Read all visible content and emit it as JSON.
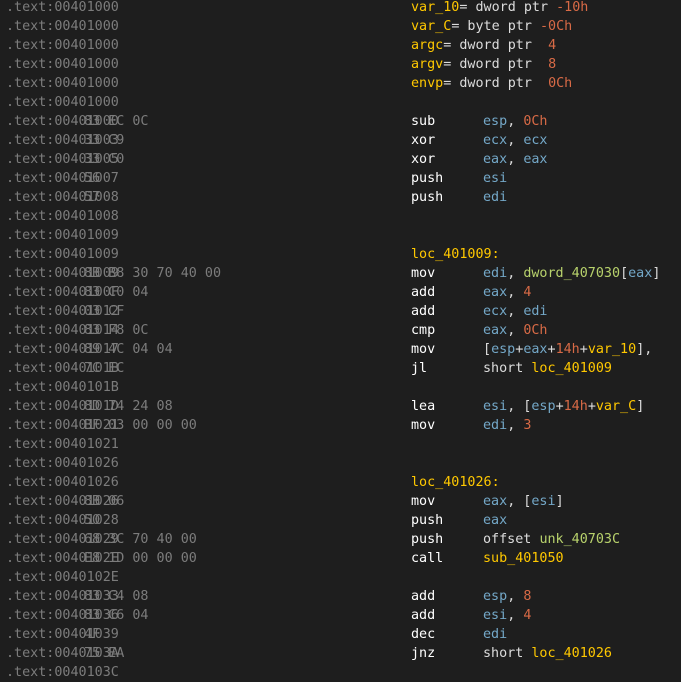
{
  "colors": {
    "background": "#1e1e1e",
    "address": "#7c7c7c",
    "mnemonic": "#ffffff",
    "label": "#ffc800",
    "register": "#74a8c8",
    "number": "#d86a46",
    "symbol": "#b8d26c",
    "text": "#dcdcdc"
  },
  "lines": [
    {
      "addr": ".text:00401000",
      "bytes": "",
      "code": [
        [
          "lbl",
          "var_10"
        ],
        [
          "dim",
          "= dword ptr "
        ],
        [
          "num",
          "-10h"
        ]
      ]
    },
    {
      "addr": ".text:00401000",
      "bytes": "",
      "code": [
        [
          "lbl",
          "var_C"
        ],
        [
          "dim",
          "= byte ptr "
        ],
        [
          "num",
          "-0Ch"
        ]
      ]
    },
    {
      "addr": ".text:00401000",
      "bytes": "",
      "code": [
        [
          "lbl",
          "argc"
        ],
        [
          "dim",
          "= dword ptr  "
        ],
        [
          "num",
          "4"
        ]
      ]
    },
    {
      "addr": ".text:00401000",
      "bytes": "",
      "code": [
        [
          "lbl",
          "argv"
        ],
        [
          "dim",
          "= dword ptr  "
        ],
        [
          "num",
          "8"
        ]
      ]
    },
    {
      "addr": ".text:00401000",
      "bytes": "",
      "code": [
        [
          "lbl",
          "envp"
        ],
        [
          "dim",
          "= dword ptr  "
        ],
        [
          "num",
          "0Ch"
        ]
      ]
    },
    {
      "addr": ".text:00401000",
      "bytes": ""
    },
    {
      "addr": ".text:00401000",
      "bytes": "83 EC 0C",
      "mn": "sub",
      "ops": [
        [
          "reg",
          "esp"
        ],
        [
          "dim",
          ", "
        ],
        [
          "num",
          "0Ch"
        ]
      ]
    },
    {
      "addr": ".text:00401003",
      "bytes": "33 C9",
      "mn": "xor",
      "ops": [
        [
          "reg",
          "ecx"
        ],
        [
          "dim",
          ", "
        ],
        [
          "reg",
          "ecx"
        ]
      ]
    },
    {
      "addr": ".text:00401005",
      "bytes": "33 C0",
      "mn": "xor",
      "ops": [
        [
          "reg",
          "eax"
        ],
        [
          "dim",
          ", "
        ],
        [
          "reg",
          "eax"
        ]
      ]
    },
    {
      "addr": ".text:00401007",
      "bytes": "56",
      "mn": "push",
      "ops": [
        [
          "reg",
          "esi"
        ]
      ]
    },
    {
      "addr": ".text:00401008",
      "bytes": "57",
      "mn": "push",
      "ops": [
        [
          "reg",
          "edi"
        ]
      ]
    },
    {
      "addr": ".text:00401008",
      "bytes": ""
    },
    {
      "addr": ".text:00401009",
      "bytes": ""
    },
    {
      "addr": ".text:00401009",
      "bytes": "",
      "code": [
        [
          "lbl",
          "loc_401009:"
        ]
      ]
    },
    {
      "addr": ".text:00401009",
      "bytes": "8B B8 30 70 40 00",
      "mn": "mov",
      "ops": [
        [
          "reg",
          "edi"
        ],
        [
          "dim",
          ", "
        ],
        [
          "sym",
          "dword_407030"
        ],
        [
          "dim",
          "["
        ],
        [
          "reg",
          "eax"
        ],
        [
          "dim",
          "]"
        ]
      ]
    },
    {
      "addr": ".text:0040100F",
      "bytes": "83 C0 04",
      "mn": "add",
      "ops": [
        [
          "reg",
          "eax"
        ],
        [
          "dim",
          ", "
        ],
        [
          "num",
          "4"
        ]
      ]
    },
    {
      "addr": ".text:00401012",
      "bytes": "03 CF",
      "mn": "add",
      "ops": [
        [
          "reg",
          "ecx"
        ],
        [
          "dim",
          ", "
        ],
        [
          "reg",
          "edi"
        ]
      ]
    },
    {
      "addr": ".text:00401014",
      "bytes": "83 F8 0C",
      "mn": "cmp",
      "ops": [
        [
          "reg",
          "eax"
        ],
        [
          "dim",
          ", "
        ],
        [
          "num",
          "0Ch"
        ]
      ]
    },
    {
      "addr": ".text:00401017",
      "bytes": "89 4C 04 04",
      "mn": "mov",
      "ops": [
        [
          "dim",
          "["
        ],
        [
          "reg",
          "esp"
        ],
        [
          "dim",
          "+"
        ],
        [
          "reg",
          "eax"
        ],
        [
          "dim",
          "+"
        ],
        [
          "num",
          "14h"
        ],
        [
          "dim",
          "+"
        ],
        [
          "lbl",
          "var_10"
        ],
        [
          "dim",
          "],"
        ]
      ]
    },
    {
      "addr": ".text:0040101B",
      "bytes": "7C EC",
      "mn": "jl",
      "ops": [
        [
          "dim",
          "short "
        ],
        [
          "lbl",
          "loc_401009"
        ]
      ]
    },
    {
      "addr": ".text:0040101B",
      "bytes": ""
    },
    {
      "addr": ".text:0040101D",
      "bytes": "8D 74 24 08",
      "mn": "lea",
      "ops": [
        [
          "reg",
          "esi"
        ],
        [
          "dim",
          ", ["
        ],
        [
          "reg",
          "esp"
        ],
        [
          "dim",
          "+"
        ],
        [
          "num",
          "14h"
        ],
        [
          "dim",
          "+"
        ],
        [
          "lbl",
          "var_C"
        ],
        [
          "dim",
          "]"
        ]
      ]
    },
    {
      "addr": ".text:00401021",
      "bytes": "BF 03 00 00 00",
      "mn": "mov",
      "ops": [
        [
          "reg",
          "edi"
        ],
        [
          "dim",
          ", "
        ],
        [
          "num",
          "3"
        ]
      ]
    },
    {
      "addr": ".text:00401021",
      "bytes": ""
    },
    {
      "addr": ".text:00401026",
      "bytes": ""
    },
    {
      "addr": ".text:00401026",
      "bytes": "",
      "code": [
        [
          "lbl",
          "loc_401026:"
        ]
      ]
    },
    {
      "addr": ".text:00401026",
      "bytes": "8B 06",
      "mn": "mov",
      "ops": [
        [
          "reg",
          "eax"
        ],
        [
          "dim",
          ", ["
        ],
        [
          "reg",
          "esi"
        ],
        [
          "dim",
          "]"
        ]
      ]
    },
    {
      "addr": ".text:00401028",
      "bytes": "50",
      "mn": "push",
      "ops": [
        [
          "reg",
          "eax"
        ]
      ]
    },
    {
      "addr": ".text:00401029",
      "bytes": "68 3C 70 40 00",
      "mn": "push",
      "ops": [
        [
          "dim",
          "offset "
        ],
        [
          "sym",
          "unk_40703C"
        ]
      ]
    },
    {
      "addr": ".text:0040102E",
      "bytes": "E8 1D 00 00 00",
      "mn": "call",
      "ops": [
        [
          "lbl",
          "sub_401050"
        ]
      ]
    },
    {
      "addr": ".text:0040102E",
      "bytes": ""
    },
    {
      "addr": ".text:00401033",
      "bytes": "83 C4 08",
      "mn": "add",
      "ops": [
        [
          "reg",
          "esp"
        ],
        [
          "dim",
          ", "
        ],
        [
          "num",
          "8"
        ]
      ]
    },
    {
      "addr": ".text:00401036",
      "bytes": "83 C6 04",
      "mn": "add",
      "ops": [
        [
          "reg",
          "esi"
        ],
        [
          "dim",
          ", "
        ],
        [
          "num",
          "4"
        ]
      ]
    },
    {
      "addr": ".text:00401039",
      "bytes": "4F",
      "mn": "dec",
      "ops": [
        [
          "reg",
          "edi"
        ]
      ]
    },
    {
      "addr": ".text:0040103A",
      "bytes": "75 EA",
      "mn": "jnz",
      "ops": [
        [
          "dim",
          "short "
        ],
        [
          "lbl",
          "loc_401026"
        ]
      ]
    },
    {
      "addr": ".text:0040103C",
      "bytes": ""
    }
  ]
}
